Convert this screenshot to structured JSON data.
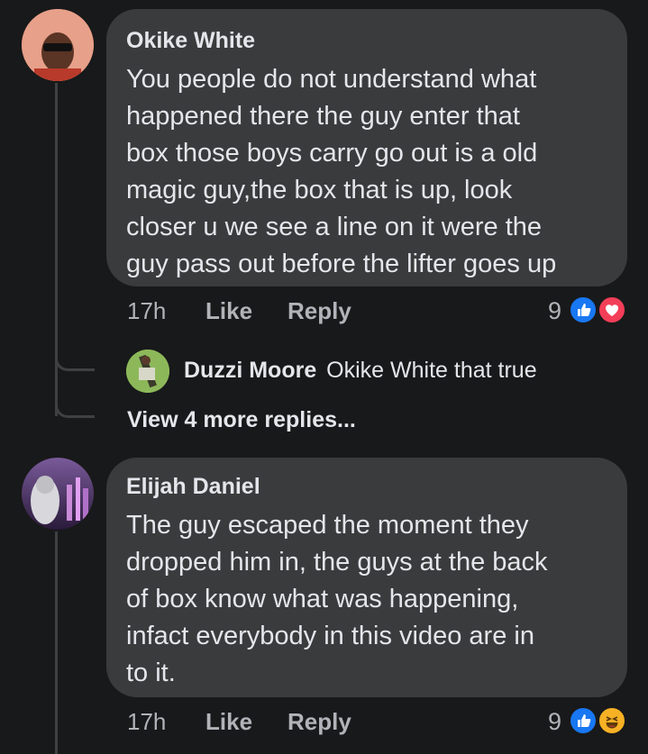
{
  "comments": [
    {
      "author": "Okike White",
      "text": "You people do not understand what\nhappened there the guy enter that\nbox those boys carry go out is a old\nmagic guy,the box that is up, look\ncloser u we see a line on it were the\nguy pass out before the lifter goes up",
      "time": "17h",
      "like_label": "Like",
      "reply_label": "Reply",
      "reaction_count": "9",
      "reactions": [
        "like-reaction-icon",
        "love-reaction-icon"
      ]
    },
    {
      "author": "Elijah Daniel",
      "text": "The guy escaped the moment they\ndropped him in, the guys at the back\nof box know what was happening,\ninfact everybody in this video are in\nto it.",
      "time": "17h",
      "like_label": "Like",
      "reply_label": "Reply",
      "reaction_count": "9",
      "reactions": [
        "like-reaction-icon",
        "haha-reaction-icon"
      ]
    }
  ],
  "reply_preview": {
    "author": "Duzzi Moore",
    "text": "Okike White that true"
  },
  "view_more_replies": "View 4 more replies...",
  "colors": {
    "background": "#18191a",
    "bubble": "#3a3b3c",
    "like_blue": "#1877f2",
    "love_red": "#f33e58",
    "haha_yellow": "#f7b125"
  }
}
